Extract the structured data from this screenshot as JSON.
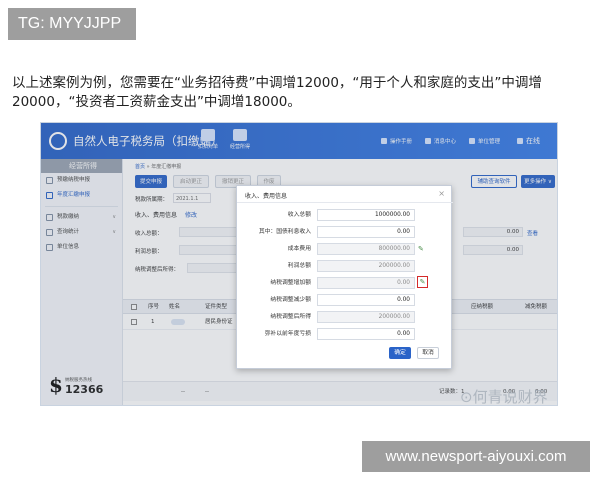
{
  "tag": {
    "text": "TG: MYYJJPP"
  },
  "intro": {
    "text": "以上述案例为例，您需要在“业务招待费”中调增12000，“用于个人和家庭的支出”中调增20000，“投资者工资薪金支出”中调增18000。"
  },
  "app": {
    "title": "自然人电子税务局（扣缴端）",
    "header_buttons": [
      {
        "icon": "document-stack-icon",
        "label": "扣扣对单"
      },
      {
        "icon": "data-icon",
        "label": "经营所得"
      }
    ],
    "header_right": [
      "操作手册",
      "消息中心",
      "单位管理",
      "在线"
    ],
    "sidebar": {
      "header": "经营所得",
      "items": [
        {
          "label": "预缴纳税申报",
          "icon": "file-icon",
          "arrow": ""
        },
        {
          "label": "年度汇缴申报",
          "icon": "file-icon",
          "arrow": "",
          "active": true
        },
        {
          "label": "税款缴纳",
          "icon": "wallet-icon",
          "arrow": "∨"
        },
        {
          "label": "查询统计",
          "icon": "search-icon",
          "arrow": "∨"
        },
        {
          "label": "单位信息",
          "icon": "building-icon",
          "arrow": ""
        }
      ],
      "hotline_label": "纳税服务热线",
      "hotline_number": "12366"
    },
    "main": {
      "breadcrumb_home": "首页",
      "breadcrumb_sep": "»",
      "breadcrumb_page": "年度汇缴申报",
      "toolbar": [
        "提交申报",
        "启动更正",
        "撤销更正",
        "作废"
      ],
      "toolbar_right": [
        "辅助查询软件",
        "更多操作 ∨"
      ],
      "period_label": "税款所属期：",
      "period_value": "2021.1.1",
      "section_title": "收入、费用信息",
      "section_edit": "修改",
      "form_labels": [
        "收入总额：",
        "利润总额：",
        "纳税调整后所得："
      ],
      "side_values": [
        "0.00",
        "0.00"
      ],
      "side_link": "查看",
      "table_headers": [
        "序号",
        "姓名",
        "证件类型",
        "应纳税额",
        "减免税额"
      ],
      "row": {
        "index": "1",
        "id_type": "居民身份证",
        "tax": "",
        "relief": ""
      },
      "footer_left": [
        "--",
        "--"
      ],
      "footer_count": "记录数：1",
      "footer_values": [
        "0.00",
        "0.00"
      ]
    },
    "modal": {
      "title": "收入、费用信息",
      "close": "×",
      "rows": [
        {
          "label": "收入总额",
          "value": "1000000.00",
          "readonly": false,
          "pen": false
        },
        {
          "label": "其中：国债利息收入",
          "value": "0.00",
          "readonly": false,
          "pen": false
        },
        {
          "label": "成本费用",
          "value": "800000.00",
          "readonly": true,
          "pen": true
        },
        {
          "label": "利润总额",
          "value": "200000.00",
          "readonly": true,
          "pen": false
        },
        {
          "label": "纳税调整增加额",
          "value": "0.00",
          "readonly": true,
          "pen": true,
          "highlight": true
        },
        {
          "label": "纳税调整减少额",
          "value": "0.00",
          "readonly": false,
          "pen": false
        },
        {
          "label": "纳税调整后所得",
          "value": "200000.00",
          "readonly": true,
          "pen": false
        },
        {
          "label": "弥补以前年度亏损",
          "value": "0.00",
          "readonly": false,
          "pen": false
        }
      ],
      "ok": "确定",
      "cancel": "取消"
    }
  },
  "watermark": {
    "text": "⊙何青说财界"
  },
  "url": {
    "text": "www.newsport-aiyouxi.com"
  }
}
